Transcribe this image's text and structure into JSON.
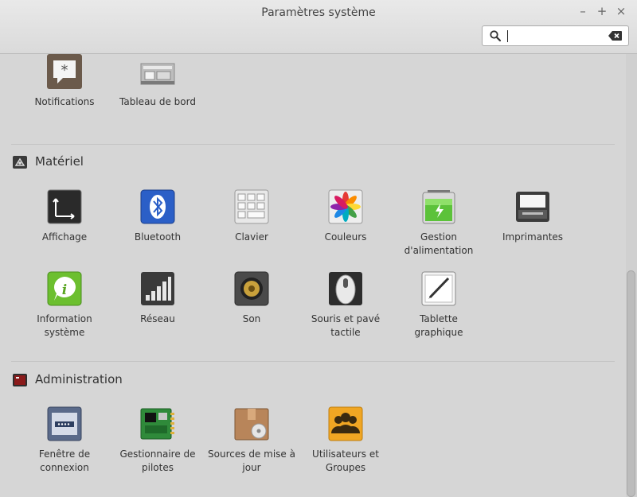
{
  "window": {
    "title": "Paramètres système",
    "minimize": "–",
    "maximize": "+",
    "close": "×"
  },
  "search": {
    "value": "",
    "placeholder": ""
  },
  "sections": {
    "personal": {
      "items": [
        {
          "label": "Notifications",
          "icon": "notifications-icon"
        },
        {
          "label": "Tableau de bord",
          "icon": "panel-icon"
        }
      ]
    },
    "hardware": {
      "title": "Matériel",
      "items": [
        {
          "label": "Affichage",
          "icon": "display-icon"
        },
        {
          "label": "Bluetooth",
          "icon": "bluetooth-icon"
        },
        {
          "label": "Clavier",
          "icon": "keyboard-icon"
        },
        {
          "label": "Couleurs",
          "icon": "color-icon"
        },
        {
          "label": "Gestion d'alimentation",
          "icon": "battery-icon"
        },
        {
          "label": "Imprimantes",
          "icon": "printer-icon"
        },
        {
          "label": "Information système",
          "icon": "info-icon"
        },
        {
          "label": "Réseau",
          "icon": "network-icon"
        },
        {
          "label": "Son",
          "icon": "speaker-icon"
        },
        {
          "label": "Souris et pavé tactile",
          "icon": "mouse-icon"
        },
        {
          "label": "Tablette graphique",
          "icon": "tablet-icon"
        }
      ]
    },
    "admin": {
      "title": "Administration",
      "items": [
        {
          "label": "Fenêtre de connexion",
          "icon": "login-window-icon"
        },
        {
          "label": "Gestionnaire de pilotes",
          "icon": "driver-icon"
        },
        {
          "label": "Sources de mise à jour",
          "icon": "software-sources-icon"
        },
        {
          "label": "Utilisateurs et Groupes",
          "icon": "users-icon"
        }
      ]
    }
  }
}
